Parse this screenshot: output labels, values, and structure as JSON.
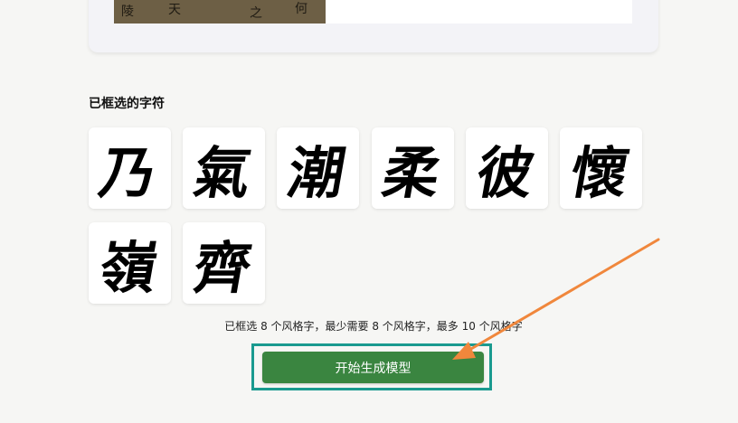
{
  "section_title": "已框选的字符",
  "characters": [
    "乃",
    "氣",
    "潮",
    "柔",
    "彼",
    "懷",
    "嶺",
    "齊"
  ],
  "status": "已框选 8 个风格字，最少需要 8 个风格字，最多 10 个风格字",
  "start_button_label": "开始生成模型",
  "colors": {
    "button": "#3a8540",
    "highlight_border": "#1a9a8f",
    "arrow": "#f0873c"
  }
}
